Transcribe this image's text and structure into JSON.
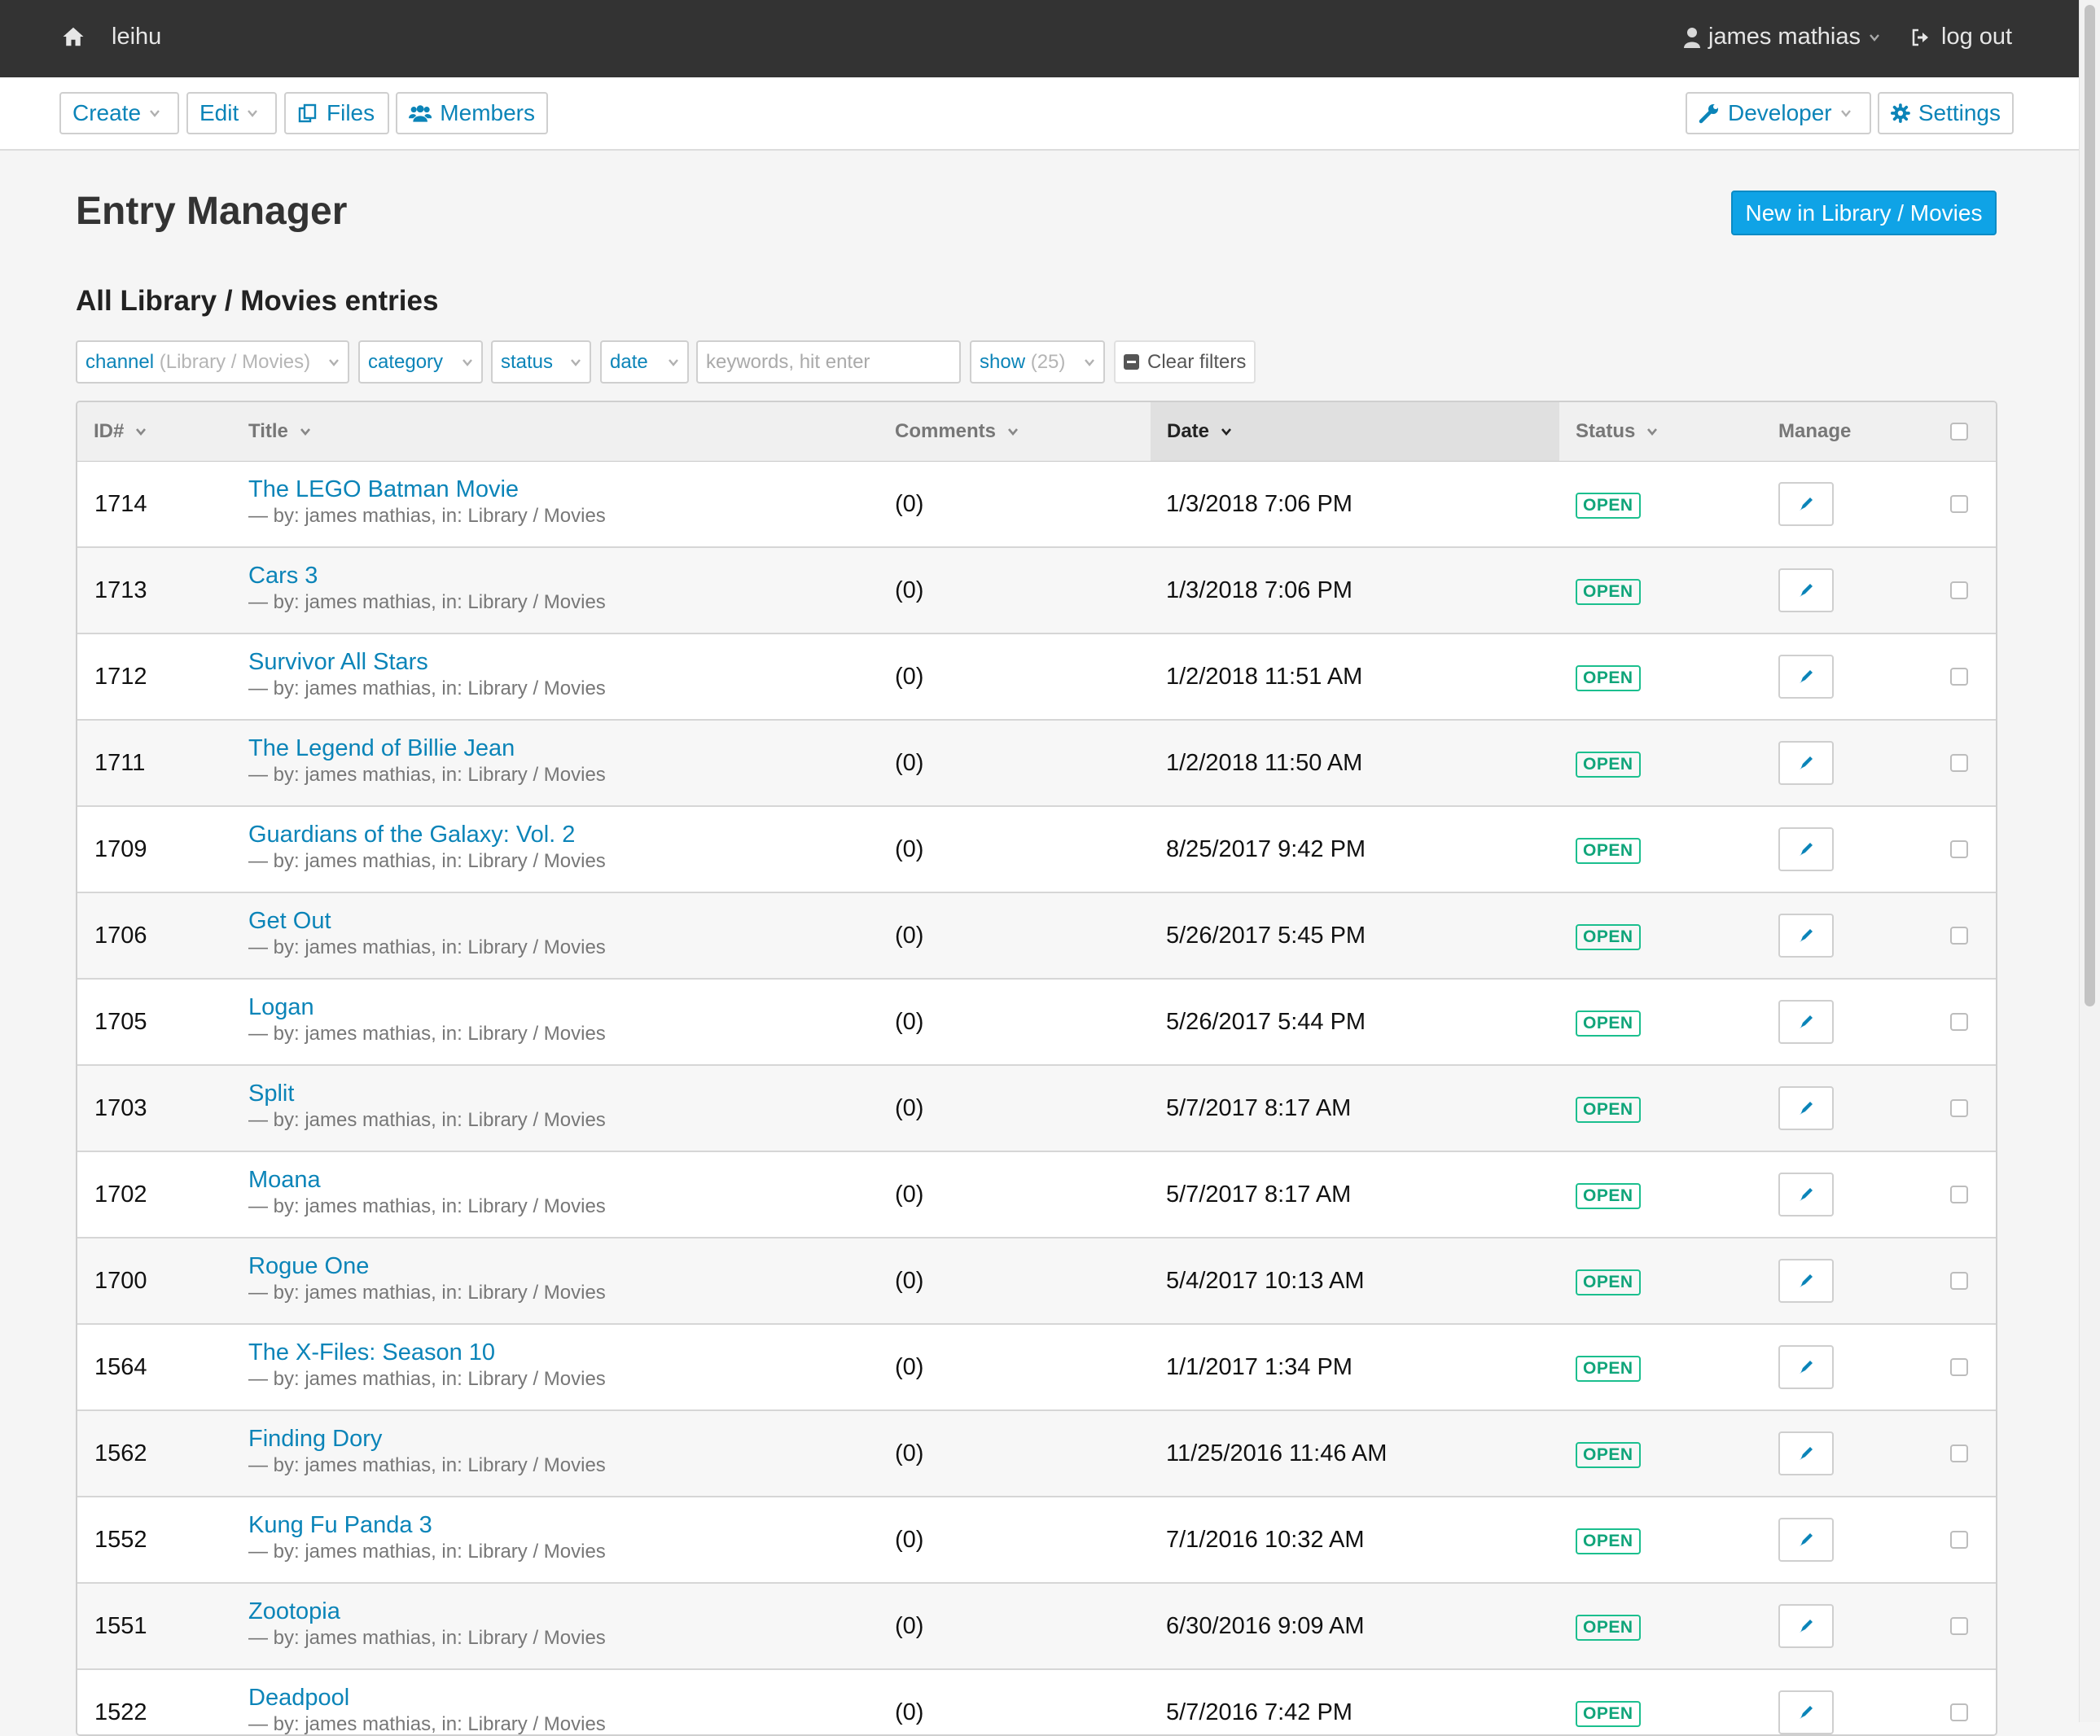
{
  "topbar": {
    "site_name": "leihu",
    "user_name": "james mathias",
    "logout_label": "log out"
  },
  "toolbar": {
    "create_label": "Create",
    "edit_label": "Edit",
    "files_label": "Files",
    "members_label": "Members",
    "developer_label": "Developer",
    "settings_label": "Settings"
  },
  "page": {
    "title": "Entry Manager",
    "new_button_label": "New in Library / Movies",
    "subtitle": "All Library / Movies entries"
  },
  "filters": {
    "channel_label": "channel",
    "channel_value": "(Library / Movies)",
    "category_label": "category",
    "status_label": "status",
    "date_label": "date",
    "search_placeholder": "keywords, hit enter",
    "show_label": "show",
    "show_value": "(25)",
    "clear_label": "Clear filters"
  },
  "table": {
    "columns": {
      "id": "ID#",
      "title": "Title",
      "comments": "Comments",
      "date": "Date",
      "status": "Status",
      "manage": "Manage"
    },
    "sorted_column": "Date",
    "rows": [
      {
        "id": "1714",
        "title": "The LEGO Batman Movie",
        "meta": "— by: james mathias, in: Library / Movies",
        "comments": "(0)",
        "date": "1/3/2018 7:06 PM",
        "status": "OPEN"
      },
      {
        "id": "1713",
        "title": "Cars 3",
        "meta": "— by: james mathias, in: Library / Movies",
        "comments": "(0)",
        "date": "1/3/2018 7:06 PM",
        "status": "OPEN"
      },
      {
        "id": "1712",
        "title": "Survivor All Stars",
        "meta": "— by: james mathias, in: Library / Movies",
        "comments": "(0)",
        "date": "1/2/2018 11:51 AM",
        "status": "OPEN"
      },
      {
        "id": "1711",
        "title": "The Legend of Billie Jean",
        "meta": "— by: james mathias, in: Library / Movies",
        "comments": "(0)",
        "date": "1/2/2018 11:50 AM",
        "status": "OPEN"
      },
      {
        "id": "1709",
        "title": "Guardians of the Galaxy: Vol. 2",
        "meta": "— by: james mathias, in: Library / Movies",
        "comments": "(0)",
        "date": "8/25/2017 9:42 PM",
        "status": "OPEN"
      },
      {
        "id": "1706",
        "title": "Get Out",
        "meta": "— by: james mathias, in: Library / Movies",
        "comments": "(0)",
        "date": "5/26/2017 5:45 PM",
        "status": "OPEN"
      },
      {
        "id": "1705",
        "title": "Logan",
        "meta": "— by: james mathias, in: Library / Movies",
        "comments": "(0)",
        "date": "5/26/2017 5:44 PM",
        "status": "OPEN"
      },
      {
        "id": "1703",
        "title": "Split",
        "meta": "— by: james mathias, in: Library / Movies",
        "comments": "(0)",
        "date": "5/7/2017 8:17 AM",
        "status": "OPEN"
      },
      {
        "id": "1702",
        "title": "Moana",
        "meta": "— by: james mathias, in: Library / Movies",
        "comments": "(0)",
        "date": "5/7/2017 8:17 AM",
        "status": "OPEN"
      },
      {
        "id": "1700",
        "title": "Rogue One",
        "meta": "— by: james mathias, in: Library / Movies",
        "comments": "(0)",
        "date": "5/4/2017 10:13 AM",
        "status": "OPEN"
      },
      {
        "id": "1564",
        "title": "The X-Files: Season 10",
        "meta": "— by: james mathias, in: Library / Movies",
        "comments": "(0)",
        "date": "1/1/2017 1:34 PM",
        "status": "OPEN"
      },
      {
        "id": "1562",
        "title": "Finding Dory",
        "meta": "— by: james mathias, in: Library / Movies",
        "comments": "(0)",
        "date": "11/25/2016 11:46 AM",
        "status": "OPEN"
      },
      {
        "id": "1552",
        "title": "Kung Fu Panda 3",
        "meta": "— by: james mathias, in: Library / Movies",
        "comments": "(0)",
        "date": "7/1/2016 10:32 AM",
        "status": "OPEN"
      },
      {
        "id": "1551",
        "title": "Zootopia",
        "meta": "— by: james mathias, in: Library / Movies",
        "comments": "(0)",
        "date": "6/30/2016 9:09 AM",
        "status": "OPEN"
      },
      {
        "id": "1522",
        "title": "Deadpool",
        "meta": "— by: james mathias, in: Library / Movies",
        "comments": "(0)",
        "date": "5/7/2016 7:42 PM",
        "status": "OPEN"
      }
    ]
  },
  "icons": {
    "home": "home-icon",
    "user": "user-icon",
    "logout": "logout-icon",
    "files": "files-icon",
    "members": "members-icon",
    "developer": "wrench-icon",
    "settings": "gear-icon",
    "edit": "pencil-icon",
    "chevron": "chevron-down-icon",
    "clear": "minus-square-icon"
  },
  "colors": {
    "topbar": "#333333",
    "link": "#0b84b8",
    "primary": "#0fa3e6",
    "status_open": "#10a57a"
  }
}
